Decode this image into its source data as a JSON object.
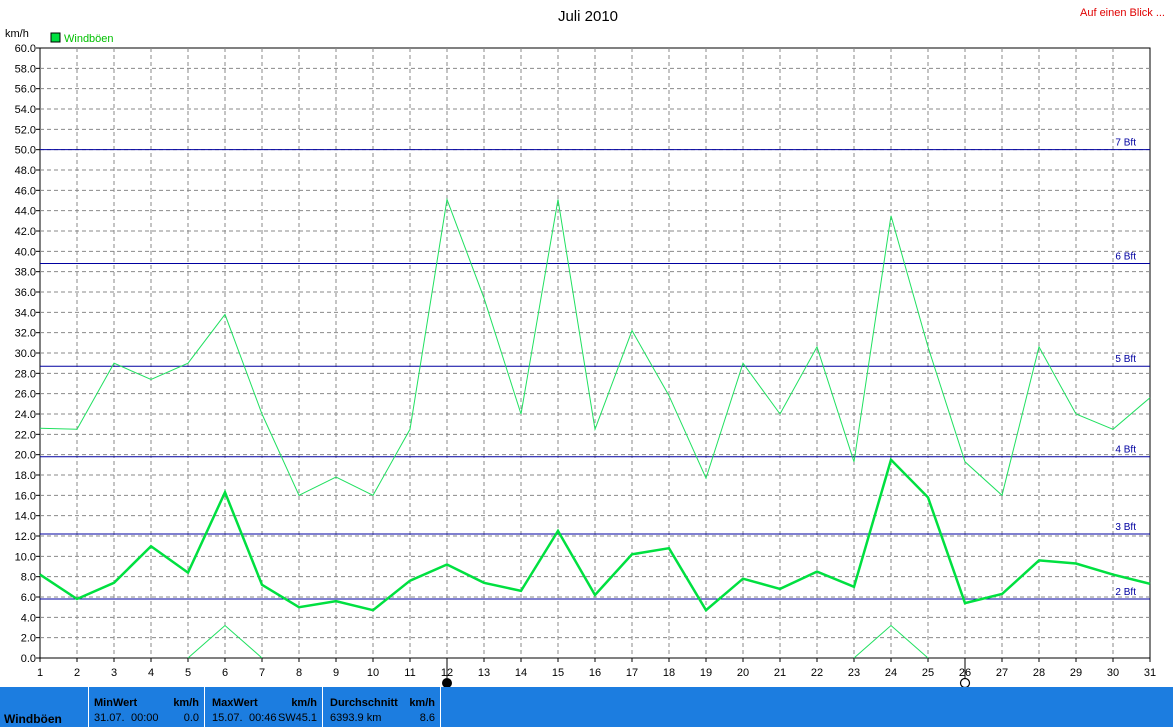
{
  "header": {
    "title": "Juli 2010",
    "overview_link": "Auf einen Blick ...",
    "y_unit": "km/h",
    "legend_label": "Windböen"
  },
  "chart_data": {
    "type": "line",
    "title": "Juli 2010",
    "ylabel": "km/h",
    "ylim": [
      0,
      60
    ],
    "y_ticks": [
      "0.0",
      "2.0",
      "4.0",
      "6.0",
      "8.0",
      "10.0",
      "12.0",
      "14.0",
      "16.0",
      "18.0",
      "20.0",
      "22.0",
      "24.0",
      "26.0",
      "28.0",
      "30.0",
      "32.0",
      "34.0",
      "36.0",
      "38.0",
      "40.0",
      "42.0",
      "44.0",
      "46.0",
      "48.0",
      "50.0",
      "52.0",
      "54.0",
      "56.0",
      "58.0",
      "60.0"
    ],
    "x": [
      1,
      2,
      3,
      4,
      5,
      6,
      7,
      8,
      9,
      10,
      11,
      12,
      13,
      14,
      15,
      16,
      17,
      18,
      19,
      20,
      21,
      22,
      23,
      24,
      25,
      26,
      27,
      28,
      29,
      30,
      31
    ],
    "x_ticks": [
      "1",
      "2",
      "3",
      "4",
      "5",
      "6",
      "7",
      "8",
      "9",
      "10",
      "11",
      "12",
      "13",
      "14",
      "15",
      "16",
      "17",
      "18",
      "19",
      "20",
      "21",
      "22",
      "23",
      "24",
      "25",
      "26",
      "27",
      "28",
      "29",
      "30",
      "31"
    ],
    "grid": true,
    "legend_position": "top-left",
    "series": [
      {
        "name": "Windböen",
        "color": "#00e040",
        "width": 2.5,
        "values": [
          8.2,
          5.8,
          7.4,
          11.0,
          8.4,
          16.3,
          7.2,
          5.0,
          5.6,
          4.7,
          7.6,
          9.2,
          7.4,
          6.6,
          12.5,
          6.2,
          10.2,
          10.8,
          4.7,
          7.8,
          6.8,
          8.5,
          7.0,
          19.5,
          15.8,
          5.4,
          6.3,
          9.6,
          9.3,
          8.2,
          7.3
        ]
      },
      {
        "color": "#20e060",
        "width": 1,
        "values": [
          22.6,
          22.5,
          29.0,
          27.4,
          29.0,
          33.8,
          24.0,
          16.0,
          17.8,
          16.0,
          22.5,
          45.1,
          35.4,
          24.0,
          45.1,
          22.5,
          32.2,
          25.8,
          17.7,
          29.0,
          24.0,
          30.6,
          19.3,
          43.5,
          30.6,
          19.3,
          16.0,
          30.6,
          24.0,
          22.5,
          25.6
        ]
      },
      {
        "color": "#20e060",
        "width": 1,
        "values": [
          null,
          null,
          null,
          null,
          0.0,
          3.2,
          0.0,
          null,
          null,
          null,
          null,
          null,
          null,
          null,
          null,
          null,
          null,
          null,
          null,
          null,
          null,
          null,
          0.0,
          3.2,
          0.0,
          null,
          null,
          null,
          null,
          null,
          null
        ]
      }
    ],
    "beaufort_lines": [
      {
        "label": "2 Bft",
        "value": 5.8
      },
      {
        "label": "3 Bft",
        "value": 12.2
      },
      {
        "label": "4 Bft",
        "value": 19.8
      },
      {
        "label": "5 Bft",
        "value": 28.7
      },
      {
        "label": "6 Bft",
        "value": 38.8
      },
      {
        "label": "7 Bft",
        "value": 50.0
      }
    ],
    "markers": [
      {
        "x": 12,
        "type": "full-moon-filled"
      },
      {
        "x": 26,
        "type": "moon-outline"
      }
    ]
  },
  "footer": {
    "series_label": "Windböen",
    "min": {
      "header": "MinWert",
      "unit": "km/h",
      "date": "31.07.",
      "time": "00:00",
      "value": "0.0"
    },
    "max": {
      "header": "MaxWert",
      "unit": "km/h",
      "date": "15.07.",
      "time": "00:46",
      "dir": "SW",
      "value": "45.1"
    },
    "avg": {
      "header": "Durchschnitt",
      "unit": "km/h",
      "distance": "6393.9 km",
      "value": "8.6"
    }
  },
  "colors": {
    "footer_bg": "#1c7de0",
    "grid": "#888888",
    "bft_line": "#0000a0",
    "series": "#00e040"
  }
}
